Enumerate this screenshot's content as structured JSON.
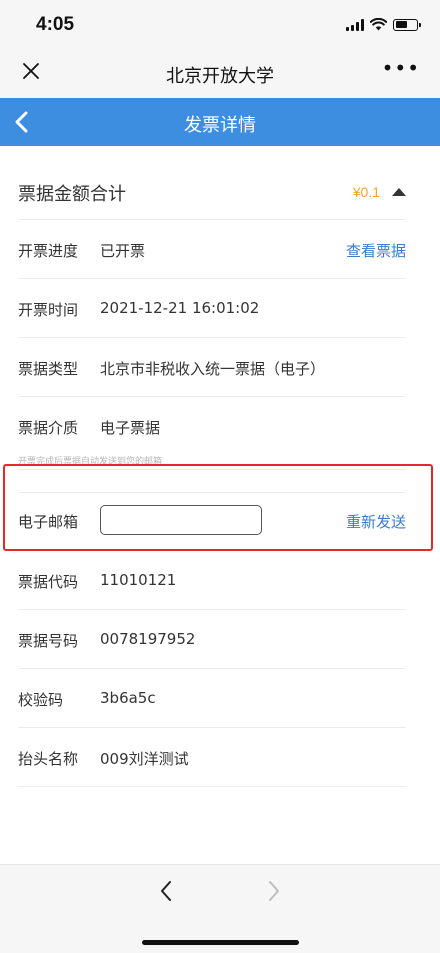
{
  "status_bar": {
    "time": "4:05"
  },
  "wechat_bar": {
    "close_icon": "close-x",
    "title": "北京开放大学",
    "more_icon": "more-dots"
  },
  "header": {
    "back_icon": "chevron-left",
    "title": "发票详情"
  },
  "summary": {
    "label": "票据金额合计",
    "amount": "¥0.1",
    "toggle_icon": "caret-up"
  },
  "rows": {
    "progress": {
      "label": "开票进度",
      "value": "已开票",
      "link": "查看票据"
    },
    "time": {
      "label": "开票时间",
      "value": "2021-12-21 16:01:02"
    },
    "type": {
      "label": "票据类型",
      "value": "北京市非税收入统一票据（电子）"
    },
    "medium": {
      "label": "票据介质",
      "value": "电子票据"
    },
    "hint": "开票完成后票据自动发送到您的邮箱",
    "email": {
      "label": "电子邮箱",
      "value": "",
      "placeholder": "",
      "action": "重新发送"
    },
    "code": {
      "label": "票据代码",
      "value": "11010121"
    },
    "number": {
      "label": "票据号码",
      "value": "0078197952"
    },
    "check": {
      "label": "校验码",
      "value": "3b6a5c"
    },
    "payer": {
      "label": "抬头名称",
      "value": "009刘洋测试"
    }
  },
  "colors": {
    "header_bg": "#3d8ee0",
    "amount": "#f5a623",
    "link": "#3a7cd1",
    "highlight": "#e8272b"
  },
  "bottom_nav": {
    "back_icon": "chevron-left",
    "forward_icon": "chevron-right"
  }
}
